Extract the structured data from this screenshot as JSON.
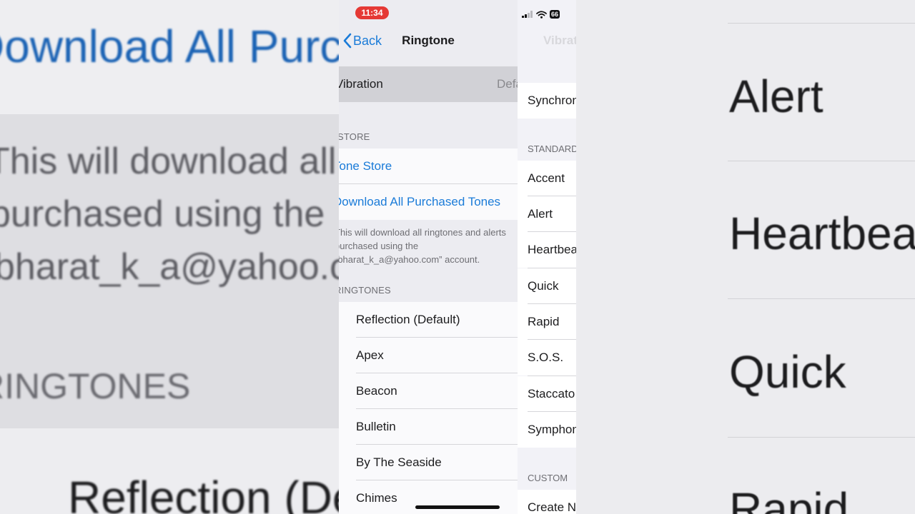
{
  "status": {
    "time": "11:34",
    "battery": "66"
  },
  "nav": {
    "back_label": "Back",
    "title": "Ringtone",
    "next_title": "Vibrations"
  },
  "vibration_row": {
    "label": "Vibration",
    "value": "Default"
  },
  "store_section": {
    "header": "STORE",
    "tone_store": "Tone Store",
    "download_all": "Download All Purchased Tones",
    "footnote": "This will download all ringtones and alerts purchased using the “bharat_k_a@yahoo.com” account."
  },
  "ringtones_section": {
    "header": "RINGTONES",
    "items": [
      "Reflection (Default)",
      "Apex",
      "Beacon",
      "Bulletin",
      "By The Seaside",
      "Chimes"
    ]
  },
  "vibrations_panel": {
    "synchronized": "Synchronized",
    "standard_header": "STANDARD",
    "standard_items": [
      "Accent",
      "Alert",
      "Heartbeat",
      "Quick",
      "Rapid",
      "S.O.S.",
      "Staccato",
      "Symphony"
    ],
    "custom_header": "CUSTOM",
    "create_new": "Create New Vibration"
  },
  "background": {
    "left_download": "Download All Purchased Tones",
    "left_footnote_1": "This will download all ringtones and alerts",
    "left_footnote_2": "purchased using the",
    "left_footnote_3": "bharat_k_a@yahoo.com” account.",
    "left_header": "RINGTONES",
    "left_first_item": "Reflection (Default)",
    "right_items": [
      "Alert",
      "Heartbeat",
      "Quick",
      "Rapid"
    ]
  },
  "colors": {
    "accent": "#1a7bd8",
    "time_pill": "#e53935"
  }
}
